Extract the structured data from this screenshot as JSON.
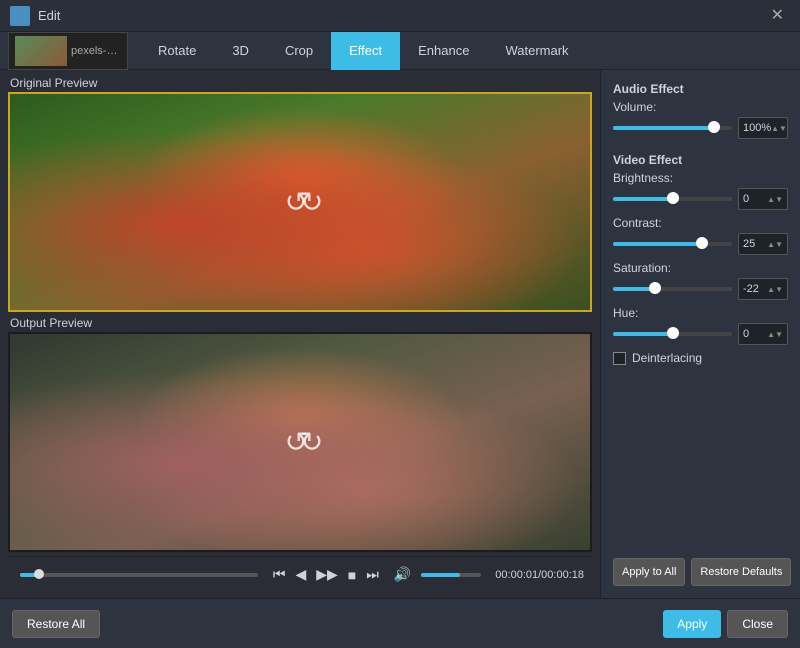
{
  "titleBar": {
    "title": "Edit",
    "closeLabel": "✕"
  },
  "fileThumbnail": {
    "name": "pexels-mang-..."
  },
  "tabs": [
    {
      "id": "rotate",
      "label": "Rotate",
      "active": false
    },
    {
      "id": "3d",
      "label": "3D",
      "active": false
    },
    {
      "id": "crop",
      "label": "Crop",
      "active": false
    },
    {
      "id": "effect",
      "label": "Effect",
      "active": true
    },
    {
      "id": "enhance",
      "label": "Enhance",
      "active": false
    },
    {
      "id": "watermark",
      "label": "Watermark",
      "active": false
    }
  ],
  "preview": {
    "originalLabel": "Original Preview",
    "outputLabel": "Output Preview"
  },
  "transport": {
    "timeDisplay": "00:00:01/00:00:18",
    "progressPercent": 8,
    "volumePercent": 65
  },
  "audioEffect": {
    "sectionTitle": "Audio Effect",
    "volume": {
      "label": "Volume:",
      "value": "100%",
      "sliderPercent": 85
    }
  },
  "videoEffect": {
    "sectionTitle": "Video Effect",
    "brightness": {
      "label": "Brightness:",
      "value": "0",
      "sliderPercent": 50
    },
    "contrast": {
      "label": "Contrast:",
      "value": "25",
      "sliderPercent": 75
    },
    "saturation": {
      "label": "Saturation:",
      "value": "-22",
      "sliderPercent": 35
    },
    "hue": {
      "label": "Hue:",
      "value": "0",
      "sliderPercent": 50
    },
    "deinterlacing": {
      "label": "Deinterlacing",
      "checked": false
    }
  },
  "subActions": {
    "applyToAll": "Apply to All",
    "restoreDefaults": "Restore Defaults"
  },
  "bottomActions": {
    "restoreAll": "Restore All",
    "apply": "Apply",
    "close": "Close"
  }
}
